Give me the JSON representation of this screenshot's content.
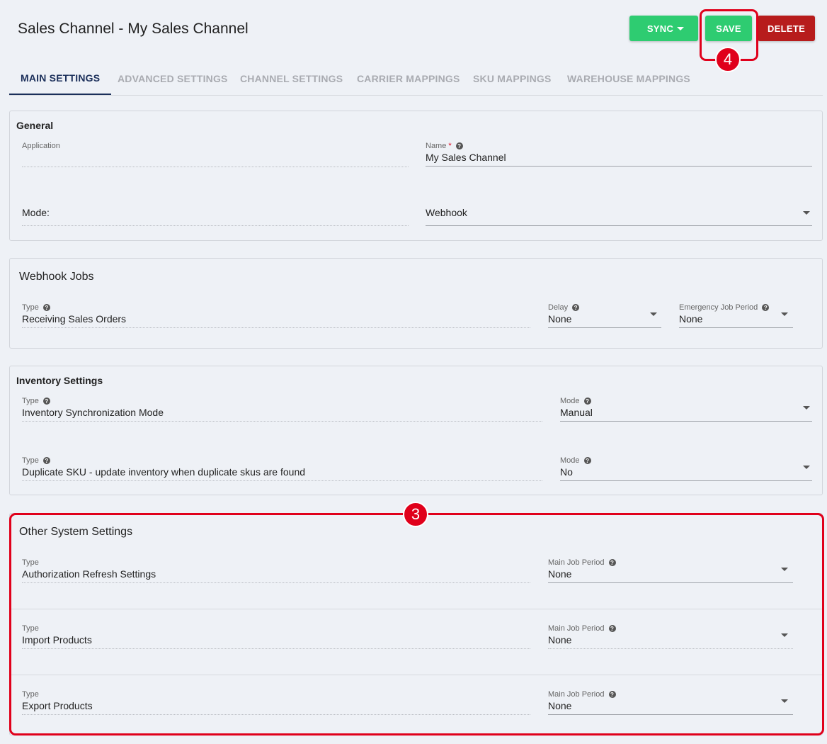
{
  "header": {
    "title": "Sales Channel - My Sales Channel",
    "sync_label": "SYNC",
    "save_label": "SAVE",
    "delete_label": "DELETE"
  },
  "tabs": [
    {
      "label": "MAIN SETTINGS",
      "active": true
    },
    {
      "label": "ADVANCED SETTINGS",
      "active": false
    },
    {
      "label": "CHANNEL SETTINGS",
      "active": false
    },
    {
      "label": "CARRIER MAPPINGS",
      "active": false
    },
    {
      "label": "SKU MAPPINGS",
      "active": false
    },
    {
      "label": "WAREHOUSE MAPPINGS",
      "active": false
    }
  ],
  "general": {
    "title": "General",
    "application_label": "Application",
    "application_value": "",
    "name_label": "Name",
    "name_required": "*",
    "name_value": "My  Sales Channel",
    "mode_label": "Mode:",
    "mode_value": "Webhook"
  },
  "webhook_jobs": {
    "title": "Webhook Jobs",
    "type_label": "Type",
    "type_value": "Receiving Sales Orders",
    "delay_label": "Delay",
    "delay_value": "None",
    "emergency_label": "Emergency Job Period",
    "emergency_value": "None"
  },
  "inventory": {
    "title": "Inventory Settings",
    "rows": [
      {
        "type_label": "Type",
        "type_value": "Inventory Synchronization Mode",
        "mode_label": "Mode",
        "mode_value": "Manual"
      },
      {
        "type_label": "Type",
        "type_value": "Duplicate SKU - update inventory when duplicate skus are found",
        "mode_label": "Mode",
        "mode_value": "No"
      }
    ]
  },
  "other": {
    "title": "Other System Settings",
    "rows": [
      {
        "type_label": "Type",
        "type_value": "Authorization Refresh Settings",
        "period_label": "Main Job Period",
        "period_value": "None"
      },
      {
        "type_label": "Type",
        "type_value": "Import Products",
        "period_label": "Main Job Period",
        "period_value": "None"
      },
      {
        "type_label": "Type",
        "type_value": "Export Products",
        "period_label": "Main Job Period",
        "period_value": "None"
      }
    ]
  },
  "annotations": {
    "save_badge": "4",
    "other_badge": "3"
  },
  "colors": {
    "accent_green": "#2ecc71",
    "delete_red": "#b71c1c",
    "annotation_red": "#e0001b",
    "active_tab": "#1b2f5a"
  },
  "icons": {
    "help": "question-circle-icon",
    "dropdown": "caret-down-icon"
  }
}
